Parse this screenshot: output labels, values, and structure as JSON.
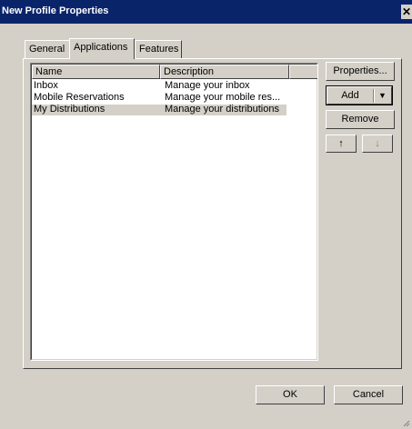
{
  "window": {
    "title": "New Profile Properties",
    "close_glyph": "✕"
  },
  "tabs": [
    {
      "label": "General",
      "active": false
    },
    {
      "label": "Applications",
      "active": true
    },
    {
      "label": "Features",
      "active": false
    }
  ],
  "list": {
    "columns": [
      "Name",
      "Description"
    ],
    "rows": [
      {
        "name": "Inbox",
        "description": "Manage your inbox",
        "selected": false
      },
      {
        "name": "Mobile Reservations",
        "description": "Manage your  mobile res...",
        "selected": false
      },
      {
        "name": "My Distributions",
        "description": "Manage your distributions",
        "selected": true
      }
    ]
  },
  "side_buttons": {
    "properties": "Properties...",
    "add": "Add",
    "add_arrow": "▼",
    "remove": "Remove",
    "move_up": "↑",
    "move_down": "↓"
  },
  "footer": {
    "ok": "OK",
    "cancel": "Cancel"
  }
}
